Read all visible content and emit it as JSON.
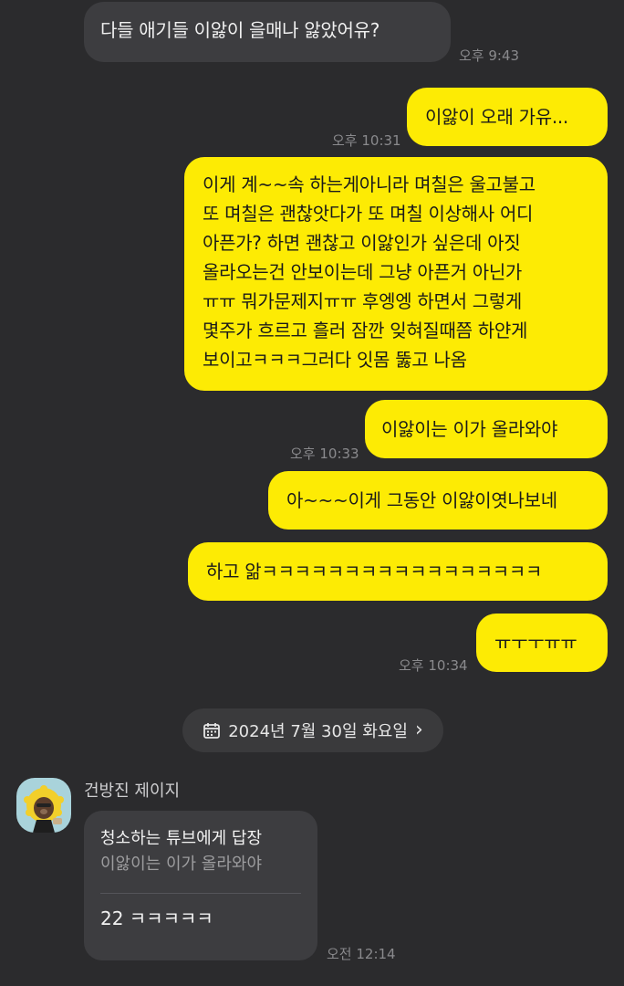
{
  "messages": [
    {
      "lines": [
        "다들 애기들 이앓이 을매나 앓았어유?"
      ],
      "time": "오후 9:43"
    },
    {
      "lines": [
        "이앓이 오래 가유..."
      ],
      "time": "오후 10:31"
    },
    {
      "lines": [
        "이게 계~~속 하는게아니라 며칠은 울고불고",
        "또 며칠은 괜찮앗다가 또 며칠 이상해사 어디",
        "아픈가? 하면 괜찮고 이앓인가 싶은데 아짓",
        "올라오는건 안보이는데 그냥 아픈거 아닌가",
        "ㅠㅠ 뭐가문제지ㅠㅠ 후엥엥 하면서 그렇게",
        "몇주가 흐르고 흘러 잠깐 잊혀질때쯤 하얀게",
        "보이고ㅋㅋㅋ그러다 잇몸 뚫고 나옴"
      ]
    },
    {
      "lines": [
        "이앓이는 이가 올라와야"
      ],
      "time": "오후 10:33"
    },
    {
      "lines": [
        "아~~~이게 그동안 이앓이엿나보네"
      ]
    },
    {
      "lines": [
        "하고 앎ㅋㅋㅋㅋㅋㅋㅋㅋㅋㅋㅋㅋㅋㅋㅋㅋㅋ"
      ]
    },
    {
      "lines": [
        "ㅠㅜㅜㅠㅠ"
      ],
      "time": "오후 10:34"
    }
  ],
  "date_divider": {
    "label": "2024년 7월 30일 화요일",
    "chevron": "›"
  },
  "reply": {
    "sender": "건방진 제이지",
    "title": "청소하는 튜브에게 답장",
    "quote": "이앓이는 이가 올라와야",
    "body": "22 ㅋㅋㅋㅋㅋ",
    "time": "오전 12:14"
  },
  "colors": {
    "background": "#2b2b2d",
    "sent_bubble": "#fdeb04",
    "received_bubble": "#3d3d40"
  },
  "icons": [
    "calendar-icon",
    "chevron-right-icon",
    "avatar"
  ]
}
